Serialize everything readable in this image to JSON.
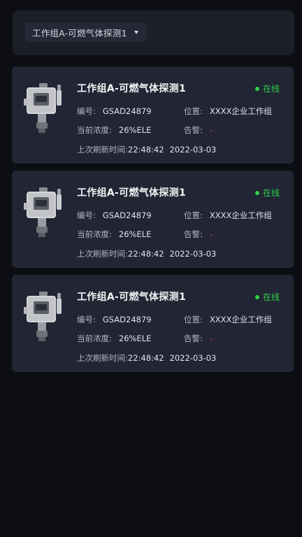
{
  "filter": {
    "selected": "工作组A-可燃气体探测1"
  },
  "colors": {
    "background": "#0d0e13",
    "card": "#222533",
    "online": "#2fd14b",
    "alarm": "#e0434b"
  },
  "labels": {
    "code": "编号:",
    "location": "位置:",
    "concentration": "当前浓度:",
    "alarm": "告警:",
    "refresh": "上次刷新时间:"
  },
  "devices": [
    {
      "icon": "gas-detector-icon",
      "name": "工作组A-可燃气体探测1",
      "status": "在线",
      "code": "GSAD24879",
      "location": "XXXX企业工作组",
      "concentration": "26%ELE",
      "alarm": "-",
      "refresh_time": "22:48:42",
      "refresh_date": "2022-03-03"
    },
    {
      "icon": "gas-detector-icon",
      "name": "工作组A-可燃气体探测1",
      "status": "在线",
      "code": "GSAD24879",
      "location": "XXXX企业工作组",
      "concentration": "26%ELE",
      "alarm": "-",
      "refresh_time": "22:48:42",
      "refresh_date": "2022-03-03"
    },
    {
      "icon": "gas-detector-icon",
      "name": "工作组A-可燃气体探测1",
      "status": "在线",
      "code": "GSAD24879",
      "location": "XXXX企业工作组",
      "concentration": "26%ELE",
      "alarm": "-",
      "refresh_time": "22:48:42",
      "refresh_date": "2022-03-03"
    }
  ]
}
